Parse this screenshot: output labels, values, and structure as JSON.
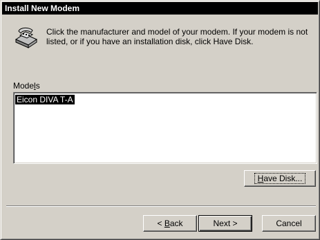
{
  "window": {
    "title": "Install New Modem"
  },
  "header": {
    "icon": "modem-telephone-icon",
    "instructions": "Click the manufacturer and model of your modem. If your modem is not listed, or if you have an installation disk, click Have Disk."
  },
  "models": {
    "label_prefix": "Mode",
    "label_mnemonic": "l",
    "label_suffix": "s",
    "items": [
      "Eicon DIVA T-A"
    ],
    "selected_index": 0
  },
  "buttons": {
    "have_disk_mnemonic": "H",
    "have_disk_rest": "ave Disk...",
    "back_prefix": "< ",
    "back_mnemonic": "B",
    "back_rest": "ack",
    "next": "Next >",
    "cancel": "Cancel"
  }
}
